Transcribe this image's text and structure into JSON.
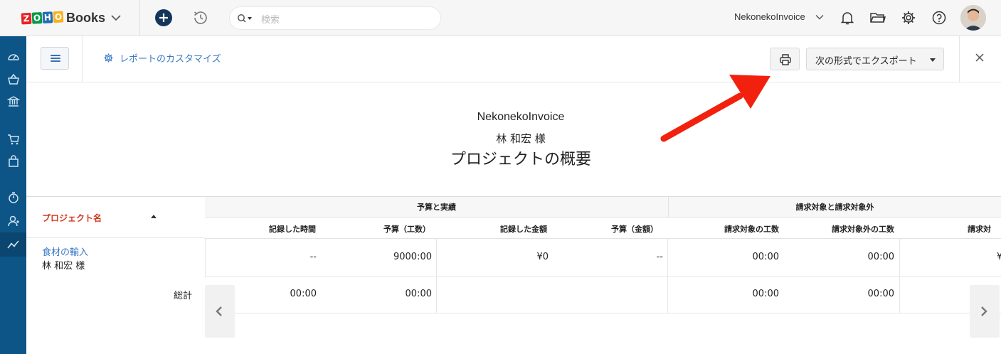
{
  "app": {
    "logo_letters": [
      "Z",
      "O",
      "H",
      "O"
    ],
    "logo_colors": [
      "#e42527",
      "#089949",
      "#226db4",
      "#f9b21d"
    ],
    "product_name": "Books"
  },
  "topbar": {
    "search_placeholder": "検索",
    "organization": "NekonekoInvoice"
  },
  "report_header": {
    "customize_label": "レポートのカスタマイズ",
    "export_label": "次の形式でエクスポート"
  },
  "report": {
    "organization": "NekonekoInvoice",
    "customer": "林 和宏 様",
    "title": "プロジェクトの概要"
  },
  "table": {
    "project_header": "プロジェクト名",
    "group_budget": "予算と実績",
    "group_billable": "請求対象と請求対象外",
    "columns": {
      "logged_hours": "記録した時間",
      "budget_hours": "予算（工数）",
      "logged_amount": "記録した金額",
      "budget_amount": "予算（金額）",
      "billable_hours": "請求対象の工数",
      "nonbillable_hours": "請求対象外の工数",
      "billable_partial": "請求対"
    },
    "row": {
      "project": "食材の輸入",
      "customer": "林 和宏 様",
      "logged_hours": "--",
      "budget_hours": "9000:00",
      "logged_amount": "¥0",
      "budget_amount": "--",
      "billable_hours": "00:00",
      "nonbillable_hours": "00:00",
      "billable_partial": "¥"
    },
    "total": {
      "label": "総計",
      "logged_hours": "00:00",
      "budget_hours": "00:00",
      "billable_hours": "00:00",
      "nonbillable_hours": "00:00"
    }
  },
  "icons": {
    "topbar": [
      "chevron-down-icon",
      "plus-icon",
      "history-icon",
      "search-icon",
      "bell-icon",
      "folder-icon",
      "gear-icon",
      "help-icon"
    ],
    "sidebar": [
      "dashboard-icon",
      "basket-icon",
      "bank-icon",
      "cart-icon",
      "bag-icon",
      "timer-icon",
      "user-icon",
      "reports-icon"
    ],
    "report_header": [
      "hamburger-icon",
      "gear-icon",
      "printer-icon",
      "close-icon"
    ]
  },
  "colors": {
    "sidebar": "#0d5587",
    "link": "#3a78c4",
    "accent_red": "#d0391f",
    "annotation_arrow": "#f2210d"
  }
}
